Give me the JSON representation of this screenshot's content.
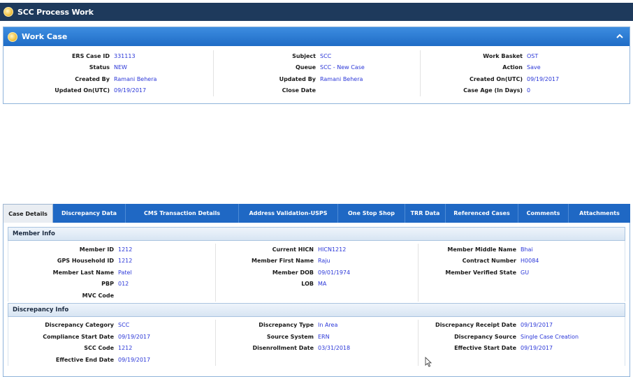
{
  "app_header": {
    "title": "SCC Process Work",
    "icon": "circle-icon"
  },
  "work_case": {
    "title": "Work Case",
    "icon": "circle-icon",
    "collapse_icon": "chevron-up-icon",
    "col1": [
      {
        "label": "ERS Case ID",
        "value": "331113"
      },
      {
        "label": "Status",
        "value": "NEW"
      },
      {
        "label": "Created By",
        "value": "Ramani Behera"
      },
      {
        "label": "Updated On(UTC)",
        "value": "09/19/2017"
      }
    ],
    "col2": [
      {
        "label": "Subject",
        "value": "SCC"
      },
      {
        "label": "Queue",
        "value": "SCC - New Case"
      },
      {
        "label": "Updated By",
        "value": "Ramani Behera"
      },
      {
        "label": "Close Date",
        "value": ""
      }
    ],
    "col3": [
      {
        "label": "Work Basket",
        "value": "OST"
      },
      {
        "label": "Action",
        "value": "Save"
      },
      {
        "label": "Created On(UTC)",
        "value": "09/19/2017"
      },
      {
        "label": "Case Age (In Days)",
        "value": "0"
      }
    ]
  },
  "tabs": [
    {
      "label": "Case Details",
      "active": true
    },
    {
      "label": "Discrepancy Data"
    },
    {
      "label": "CMS Transaction Details"
    },
    {
      "label": "Address Validation-USPS"
    },
    {
      "label": "One Stop Shop"
    },
    {
      "label": "TRR Data"
    },
    {
      "label": "Referenced Cases"
    },
    {
      "label": "Comments"
    },
    {
      "label": "Attachments"
    }
  ],
  "member_info": {
    "title": "Member Info",
    "col1": [
      {
        "label": "Member ID",
        "value": "1212"
      },
      {
        "label": "GPS Household ID",
        "value": "1212"
      },
      {
        "label": "Member Last Name",
        "value": "Patel"
      },
      {
        "label": "PBP",
        "value": "012"
      },
      {
        "label": "MVC Code",
        "value": ""
      }
    ],
    "col2": [
      {
        "label": "Current HICN",
        "value": "HICN1212"
      },
      {
        "label": "Member First Name",
        "value": "Raju"
      },
      {
        "label": "Member DOB",
        "value": "09/01/1974"
      },
      {
        "label": "LOB",
        "value": "MA"
      }
    ],
    "col3": [
      {
        "label": "Member Middle Name",
        "value": "Bhai"
      },
      {
        "label": "Contract Number",
        "value": "H0084"
      },
      {
        "label": "Member Verified State",
        "value": "GU"
      }
    ]
  },
  "discrepancy_info": {
    "title": "Discrepancy Info",
    "col1": [
      {
        "label": "Discrepancy Category",
        "value": "SCC"
      },
      {
        "label": "Compliance Start Date",
        "value": "09/19/2017"
      },
      {
        "label": "SCC Code",
        "value": "1212"
      },
      {
        "label": "Effective End Date",
        "value": "09/19/2017"
      }
    ],
    "col2": [
      {
        "label": "Discrepancy Type",
        "value": "In Area"
      },
      {
        "label": "Source System",
        "value": "ERN"
      },
      {
        "label": "Disenrollment Date",
        "value": "03/31/2018"
      }
    ],
    "col3": [
      {
        "label": "Discrepancy Receipt Date",
        "value": "09/19/2017"
      },
      {
        "label": "Discrepancy Source",
        "value": "Single Case Creation"
      },
      {
        "label": "Effective Start Date",
        "value": "09/19/2017"
      }
    ]
  }
}
